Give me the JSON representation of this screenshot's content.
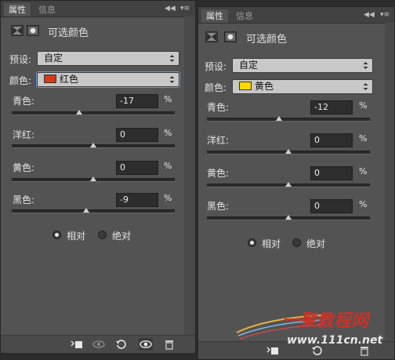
{
  "left": {
    "tabs": [
      "属性",
      "信息"
    ],
    "title": "可选颜色",
    "preset_label": "预设:",
    "preset_value": "自定",
    "colors_label": "颜色:",
    "colors_value": "红色",
    "colors_swatch": "#d63a17",
    "sliders": [
      {
        "label": "青色:",
        "value": "-17",
        "unit": "%",
        "level": -0.17
      },
      {
        "label": "洋红:",
        "value": "0",
        "unit": "%",
        "level": 0
      },
      {
        "label": "黄色:",
        "value": "0",
        "unit": "%",
        "level": 0
      },
      {
        "label": "黑色:",
        "value": "-9",
        "unit": "%",
        "level": -0.09
      }
    ],
    "method": {
      "relative": "相对",
      "absolute": "绝对",
      "selected": "relative"
    }
  },
  "right": {
    "tabs": [
      "属性",
      "信息"
    ],
    "title": "可选颜色",
    "preset_label": "预设:",
    "preset_value": "自定",
    "colors_label": "颜色:",
    "colors_value": "黄色",
    "colors_swatch": "#ffd800",
    "sliders": [
      {
        "label": "青色:",
        "value": "-12",
        "unit": "%",
        "level": -0.12
      },
      {
        "label": "洋红:",
        "value": "0",
        "unit": "%",
        "level": 0
      },
      {
        "label": "黄色:",
        "value": "0",
        "unit": "%",
        "level": 0
      },
      {
        "label": "黑色:",
        "value": "0",
        "unit": "%",
        "level": 0
      }
    ],
    "method": {
      "relative": "相对",
      "absolute": "绝对",
      "selected": "relative"
    }
  },
  "watermark": {
    "text": "一聚教程网",
    "url": "www.111cn.net"
  },
  "icons": [
    "clip-to-layer-icon",
    "view-previous-icon",
    "reset-icon",
    "visibility-eye-icon",
    "delete-trash-icon"
  ]
}
